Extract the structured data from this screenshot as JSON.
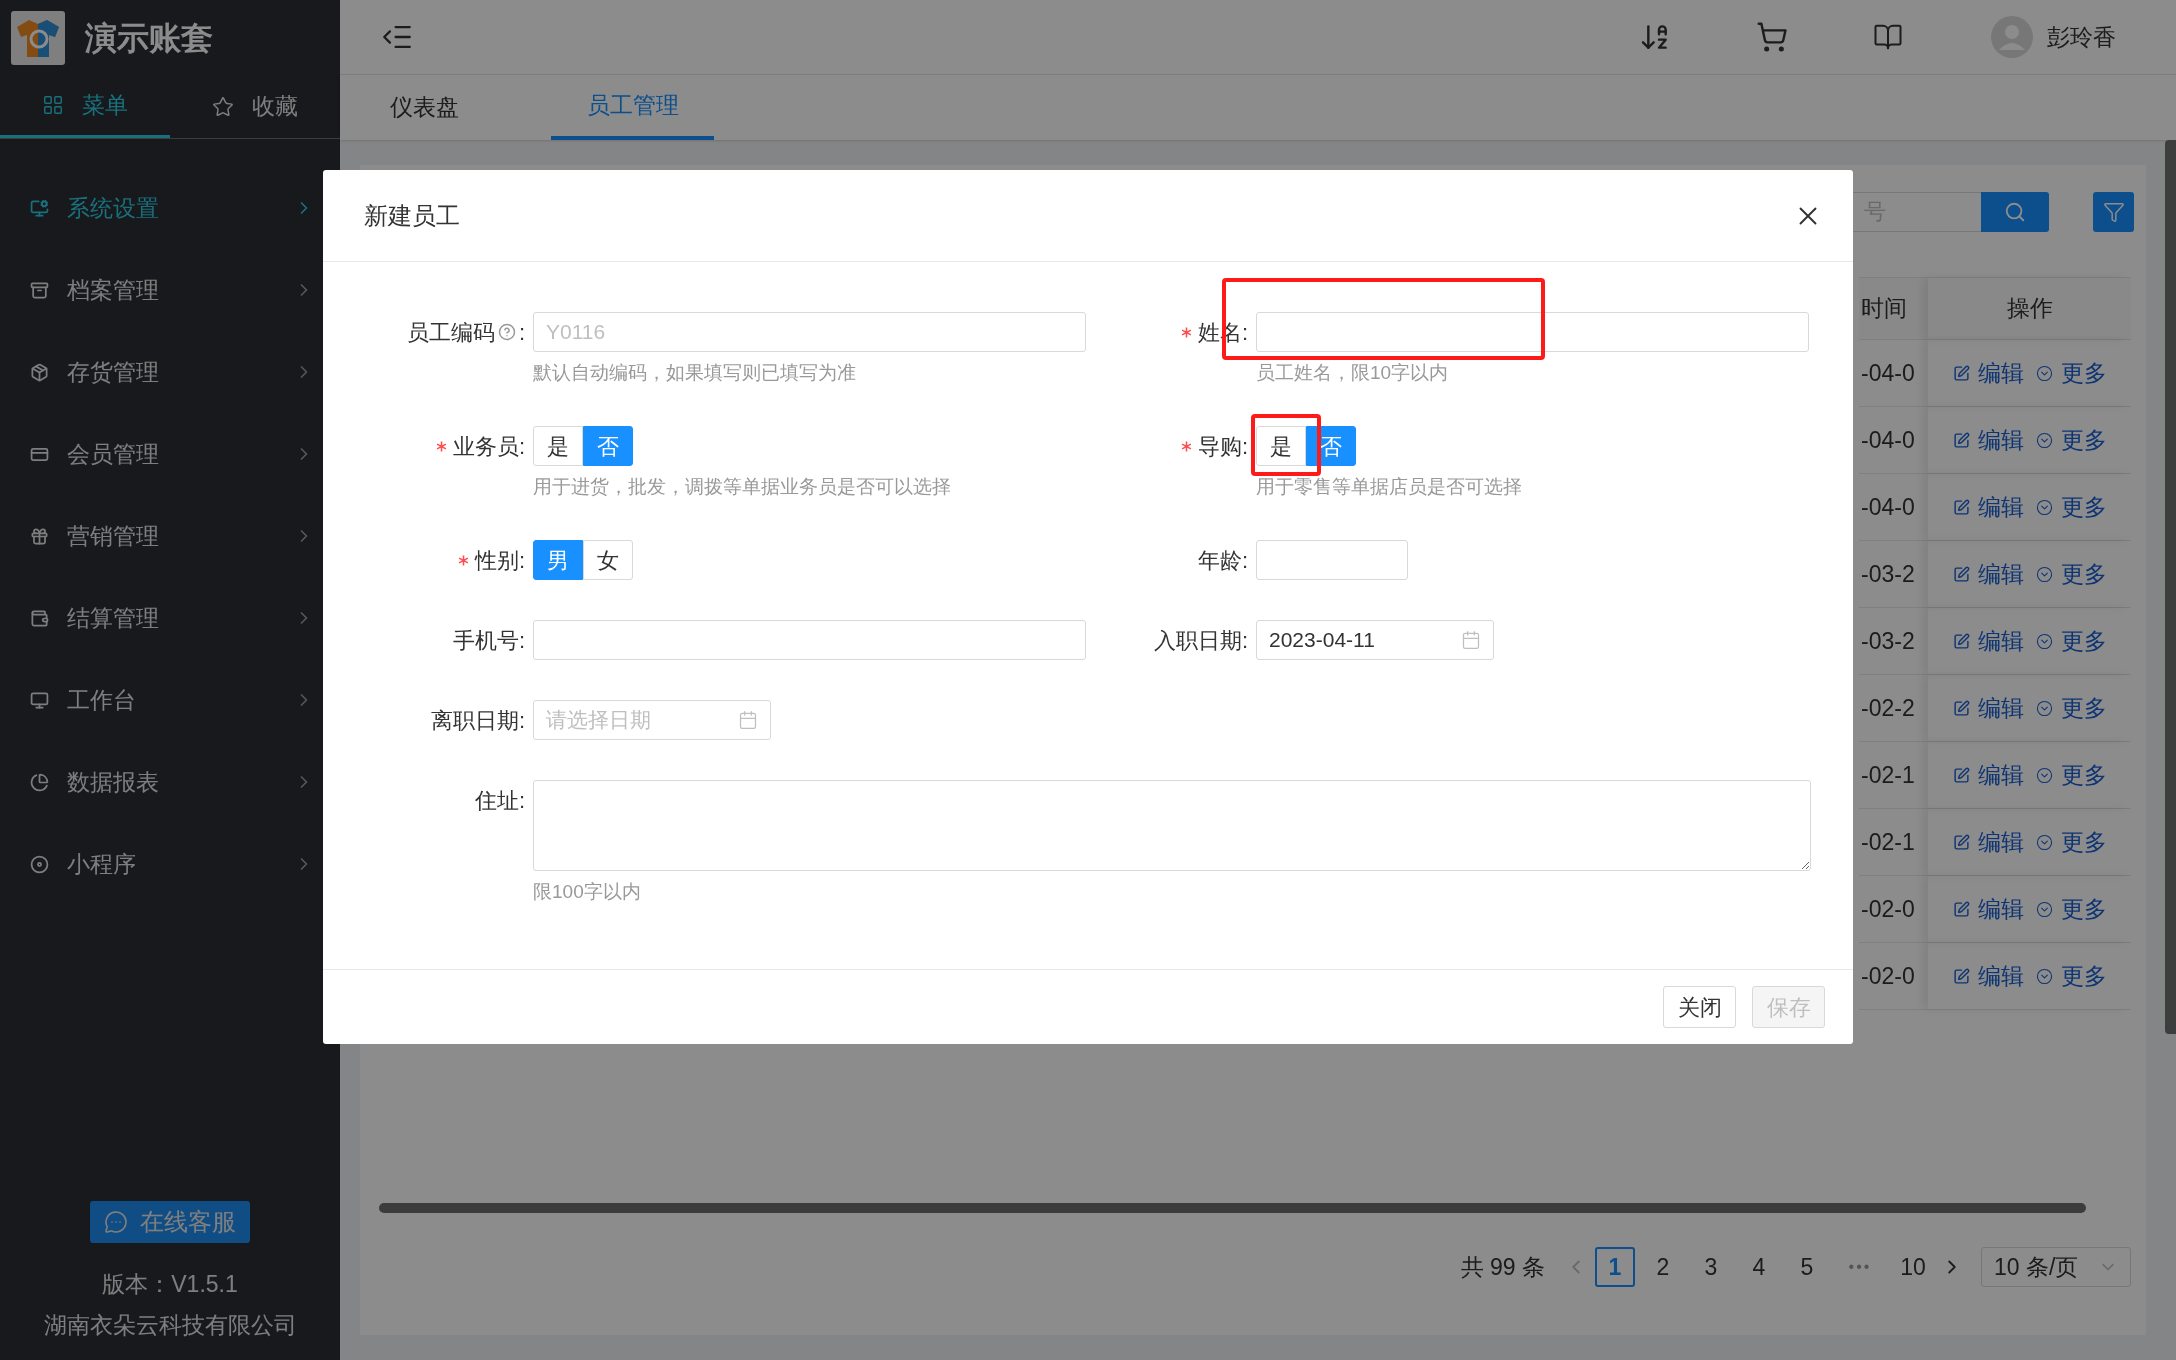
{
  "app": {
    "title": "演示账套"
  },
  "sidebar_tabs": [
    {
      "label": "菜单",
      "selected": true
    },
    {
      "label": "收藏",
      "selected": false
    }
  ],
  "sidebar": {
    "items": [
      {
        "label": "系统设置",
        "selected": true
      },
      {
        "label": "档案管理",
        "selected": false
      },
      {
        "label": "存货管理",
        "selected": false
      },
      {
        "label": "会员管理",
        "selected": false
      },
      {
        "label": "营销管理",
        "selected": false
      },
      {
        "label": "结算管理",
        "selected": false
      },
      {
        "label": "工作台",
        "selected": false
      },
      {
        "label": "数据报表",
        "selected": false
      },
      {
        "label": "小程序",
        "selected": false
      }
    ],
    "support_button": "在线客服",
    "version": "版本：V1.5.1",
    "company": "湖南衣朵云科技有限公司"
  },
  "header": {
    "user": "彭玲香"
  },
  "tabs": [
    {
      "label": "仪表盘",
      "selected": false
    },
    {
      "label": "员工管理",
      "selected": true
    }
  ],
  "search": {
    "placeholder": "号"
  },
  "table": {
    "columns": [
      "时间",
      "操作"
    ],
    "rows": [
      {
        "date": "-04-0",
        "actions": [
          "编辑",
          "更多"
        ]
      },
      {
        "date": "-04-0",
        "actions": [
          "编辑",
          "更多"
        ]
      },
      {
        "date": "-04-0",
        "actions": [
          "编辑",
          "更多"
        ]
      },
      {
        "date": "-03-2",
        "actions": [
          "编辑",
          "更多"
        ]
      },
      {
        "date": "-03-2",
        "actions": [
          "编辑",
          "更多"
        ]
      },
      {
        "date": "-02-2",
        "actions": [
          "编辑",
          "更多"
        ]
      },
      {
        "date": "-02-1",
        "actions": [
          "编辑",
          "更多"
        ]
      },
      {
        "date": "-02-1",
        "actions": [
          "编辑",
          "更多"
        ]
      },
      {
        "date": "-02-0",
        "actions": [
          "编辑",
          "更多"
        ]
      },
      {
        "date": "-02-0",
        "actions": [
          "编辑",
          "更多"
        ]
      }
    ]
  },
  "pagination": {
    "total": "共 99 条",
    "pages": [
      {
        "label": "1",
        "kind": "page",
        "selected": true
      },
      {
        "label": "2",
        "kind": "page",
        "selected": false
      },
      {
        "label": "3",
        "kind": "page",
        "selected": false
      },
      {
        "label": "4",
        "kind": "page",
        "selected": false
      },
      {
        "label": "5",
        "kind": "page",
        "selected": false
      },
      {
        "label": "•••",
        "kind": "ellipsis"
      },
      {
        "label": "10",
        "kind": "page",
        "selected": false
      }
    ],
    "page_size": "10 条/页"
  },
  "dialog": {
    "title": "新建员工",
    "rows": [
      [
        {
          "kind": "text",
          "label": "员工编码",
          "help": true,
          "suffix": ":",
          "required": false,
          "placeholder": "Y0116",
          "hint": "默认自动编码，如果填写则已填写为准"
        },
        {
          "kind": "text",
          "label": "姓名:",
          "required": true,
          "hint": "员工姓名，限10字以内"
        }
      ],
      [
        {
          "kind": "segmented",
          "label": "业务员:",
          "required": true,
          "options": [
            {
              "label": "是",
              "selected": false
            },
            {
              "label": "否",
              "selected": true
            }
          ],
          "hint": "用于进货，批发，调拨等单据业务员是否可以选择"
        },
        {
          "kind": "segmented",
          "label": "导购:",
          "required": true,
          "options": [
            {
              "label": "是",
              "selected": false
            },
            {
              "label": "否",
              "selected": true
            }
          ],
          "hint": "用于零售等单据店员是否可选择"
        }
      ],
      [
        {
          "kind": "segmented",
          "label": "性别:",
          "required": true,
          "options": [
            {
              "label": "男",
              "selected": true
            },
            {
              "label": "女",
              "selected": false
            }
          ]
        },
        {
          "kind": "short",
          "label": "年龄:",
          "required": false
        }
      ],
      [
        {
          "kind": "text",
          "label": "手机号:",
          "required": false
        },
        {
          "kind": "date",
          "label": "入职日期:",
          "required": false,
          "value": "2023-04-11"
        }
      ],
      [
        {
          "kind": "date",
          "label": "离职日期:",
          "required": false,
          "placeholder": "请选择日期"
        }
      ],
      [
        {
          "kind": "textarea",
          "label": "住址:",
          "required": false,
          "hint": "限100字以内"
        }
      ]
    ],
    "buttons": [
      {
        "label": "关闭",
        "disabled": false
      },
      {
        "label": "保存",
        "disabled": true
      }
    ]
  }
}
